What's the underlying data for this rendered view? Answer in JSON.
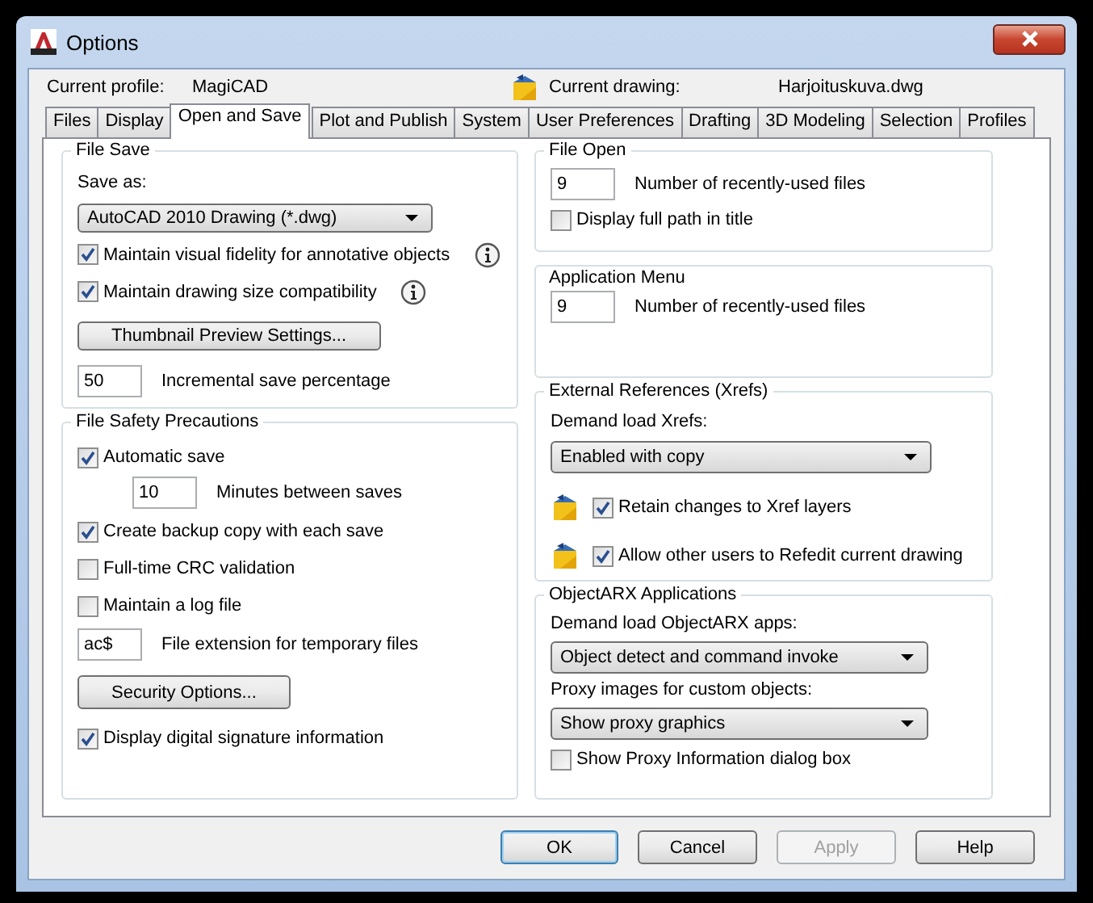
{
  "window": {
    "title": "Options"
  },
  "header": {
    "profile_label": "Current profile:",
    "profile": "MagiCAD",
    "drawing_label": "Current drawing:",
    "drawing": "Harjoituskuva.dwg"
  },
  "tabs": [
    {
      "label": "Files",
      "selected": false
    },
    {
      "label": "Display",
      "selected": false
    },
    {
      "label": "Open and Save",
      "selected": true
    },
    {
      "label": "Plot and Publish",
      "selected": false
    },
    {
      "label": "System",
      "selected": false
    },
    {
      "label": "User Preferences",
      "selected": false
    },
    {
      "label": "Drafting",
      "selected": false
    },
    {
      "label": "3D Modeling",
      "selected": false
    },
    {
      "label": "Selection",
      "selected": false
    },
    {
      "label": "Profiles",
      "selected": false
    }
  ],
  "columns": [
    [
      {
        "title": "File Save",
        "items": [
          {
            "kind": "label",
            "text": "Save as:"
          },
          {
            "kind": "dropdown",
            "value": "AutoCAD 2010 Drawing (*.dwg)"
          },
          {
            "kind": "info_checkbox",
            "label": "Maintain visual fidelity for annotative objects",
            "checked": true
          },
          {
            "kind": "info_checkbox",
            "label": "Maintain drawing size compatibility",
            "checked": true
          },
          {
            "kind": "button",
            "label": "Thumbnail Preview Settings..."
          },
          {
            "kind": "number",
            "value": "50",
            "text": "Incremental save percentage"
          }
        ]
      },
      {
        "title": "File Safety Precautions",
        "items": [
          {
            "kind": "checkbox",
            "label": "Automatic save",
            "checked": true,
            "children": [
              {
                "kind": "number",
                "value": "10",
                "text": "Minutes between saves"
              }
            ]
          },
          {
            "kind": "checkbox",
            "label": "Create backup copy with each save",
            "checked": true
          },
          {
            "kind": "checkbox",
            "label": "Full-time CRC validation",
            "checked": false
          },
          {
            "kind": "checkbox",
            "label": "Maintain a log file",
            "checked": false
          },
          {
            "kind": "number",
            "value": "ac$",
            "text": "File extension for temporary files"
          },
          {
            "kind": "button",
            "label": "Security Options..."
          },
          {
            "kind": "checkbox",
            "label": "Display digital signature information",
            "checked": true
          }
        ]
      }
    ],
    [
      {
        "title": "File Open",
        "items": [
          {
            "kind": "number",
            "value": "9",
            "text": "Number of recently-used files"
          },
          {
            "kind": "checkbox",
            "label": "Display full path in title",
            "checked": false
          }
        ]
      },
      {
        "title": "Application Menu",
        "items": [
          {
            "kind": "number",
            "value": "9",
            "text": "Number of recently-used files"
          }
        ]
      },
      {
        "title": "External References (Xrefs)",
        "items": [
          {
            "kind": "label",
            "text": "Demand load Xrefs:"
          },
          {
            "kind": "dropdown",
            "value": "Enabled with copy"
          },
          {
            "kind": "xref_checkbox",
            "label": "Retain changes to Xref layers",
            "checked": true
          },
          {
            "kind": "xref_checkbox",
            "label": "Allow other users to Refedit current drawing",
            "checked": true
          }
        ]
      },
      {
        "title": "ObjectARX Applications",
        "items": [
          {
            "kind": "label",
            "text": "Demand load ObjectARX apps:"
          },
          {
            "kind": "dropdown",
            "value": "Object detect and command invoke"
          },
          {
            "kind": "label",
            "text": "Proxy images for custom objects:"
          },
          {
            "kind": "dropdown",
            "value": "Show proxy graphics"
          },
          {
            "kind": "checkbox",
            "label": "Show Proxy Information dialog box",
            "checked": false
          }
        ]
      }
    ]
  ],
  "buttons": [
    {
      "label": "OK",
      "default": true,
      "disabled": false
    },
    {
      "label": "Cancel",
      "default": false,
      "disabled": false
    },
    {
      "label": "Apply",
      "default": false,
      "disabled": true
    },
    {
      "label": "Help",
      "default": false,
      "disabled": false
    }
  ]
}
